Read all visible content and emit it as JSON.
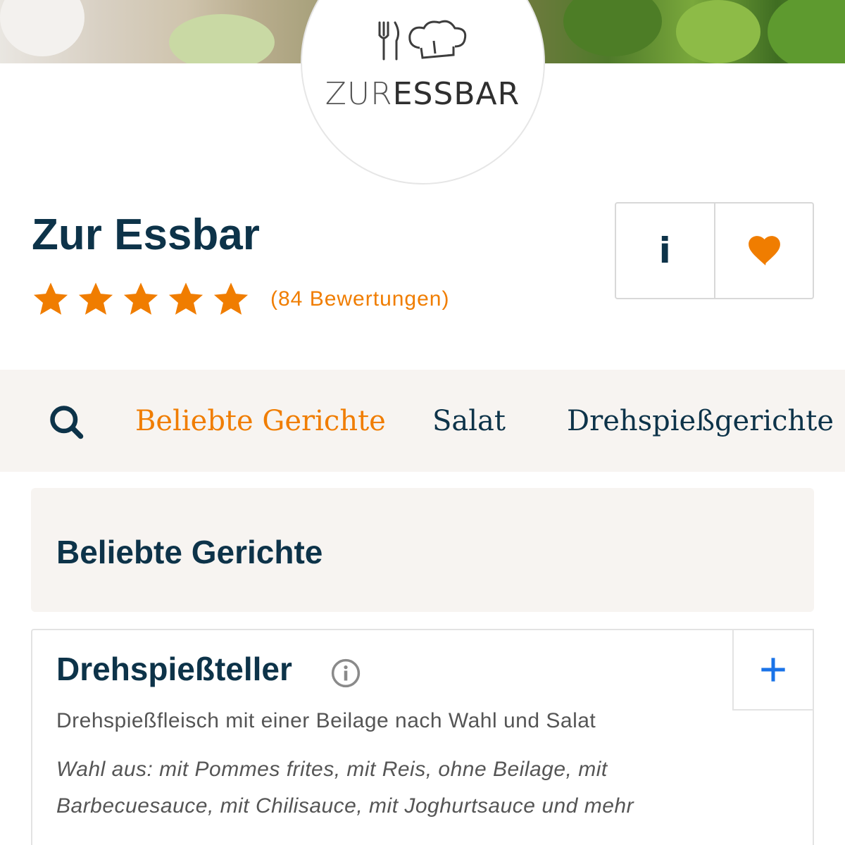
{
  "logo": {
    "text_light": "ZUR",
    "text_bold": "ESSBAR",
    "icons": [
      "fork-knife-icon",
      "chef-hat-icon"
    ]
  },
  "restaurant": {
    "name": "Zur Essbar",
    "rating_stars": 5,
    "reviews_label": "(84 Bewertungen)"
  },
  "actions": {
    "info_label": "i",
    "icons": [
      "info-icon",
      "heart-icon"
    ]
  },
  "nav": {
    "tabs": [
      {
        "label": "Beliebte Gerichte",
        "active": true
      },
      {
        "label": "Salat",
        "active": false
      },
      {
        "label": "Drehspießgerichte",
        "active": false
      }
    ]
  },
  "section": {
    "title": "Beliebte Gerichte"
  },
  "dish": {
    "name": "Drehspießteller",
    "description": "Drehspießfleisch mit einer Beilage nach Wahl und Salat",
    "options": "Wahl aus: mit Pommes frites, mit Reis, ohne Beilage, mit Barbecuesauce, mit Chilisauce, mit Joghurtsauce und mehr"
  },
  "colors": {
    "accent": "#f07d00",
    "navy": "#0d3349",
    "panel_bg": "#f7f4f1",
    "add_blue": "#1a73e8"
  }
}
